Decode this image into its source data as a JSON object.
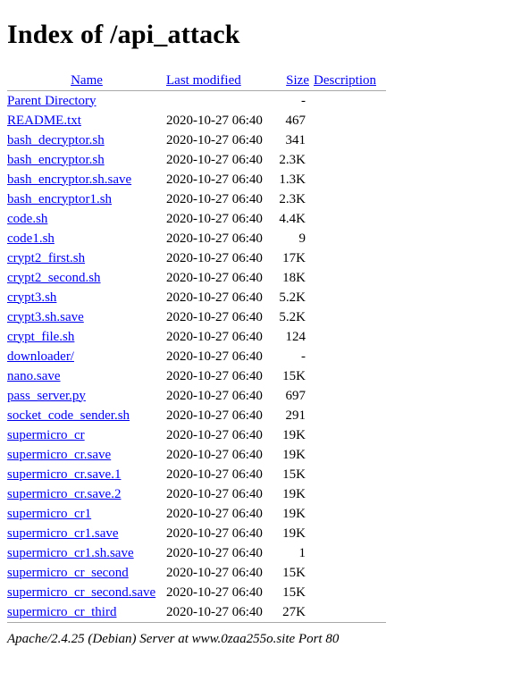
{
  "page": {
    "title": "Index of /api_attack"
  },
  "table": {
    "headers": {
      "name": "Name",
      "last_modified": "Last modified",
      "size": "Size",
      "description": "Description"
    },
    "parent": {
      "name": "Parent Directory",
      "last_modified": "",
      "size": "-",
      "description": ""
    },
    "rows": [
      {
        "name": "README.txt",
        "last_modified": "2020-10-27 06:40",
        "size": "467",
        "description": ""
      },
      {
        "name": "bash_decryptor.sh",
        "last_modified": "2020-10-27 06:40",
        "size": "341",
        "description": ""
      },
      {
        "name": "bash_encryptor.sh",
        "last_modified": "2020-10-27 06:40",
        "size": "2.3K",
        "description": ""
      },
      {
        "name": "bash_encryptor.sh.save",
        "last_modified": "2020-10-27 06:40",
        "size": "1.3K",
        "description": ""
      },
      {
        "name": "bash_encryptor1.sh",
        "last_modified": "2020-10-27 06:40",
        "size": "2.3K",
        "description": ""
      },
      {
        "name": "code.sh",
        "last_modified": "2020-10-27 06:40",
        "size": "4.4K",
        "description": ""
      },
      {
        "name": "code1.sh",
        "last_modified": "2020-10-27 06:40",
        "size": "9",
        "description": ""
      },
      {
        "name": "crypt2_first.sh",
        "last_modified": "2020-10-27 06:40",
        "size": "17K",
        "description": ""
      },
      {
        "name": "crypt2_second.sh",
        "last_modified": "2020-10-27 06:40",
        "size": "18K",
        "description": ""
      },
      {
        "name": "crypt3.sh",
        "last_modified": "2020-10-27 06:40",
        "size": "5.2K",
        "description": ""
      },
      {
        "name": "crypt3.sh.save",
        "last_modified": "2020-10-27 06:40",
        "size": "5.2K",
        "description": ""
      },
      {
        "name": "crypt_file.sh",
        "last_modified": "2020-10-27 06:40",
        "size": "124",
        "description": ""
      },
      {
        "name": "downloader/",
        "last_modified": "2020-10-27 06:40",
        "size": "-",
        "description": ""
      },
      {
        "name": "nano.save",
        "last_modified": "2020-10-27 06:40",
        "size": "15K",
        "description": ""
      },
      {
        "name": "pass_server.py",
        "last_modified": "2020-10-27 06:40",
        "size": "697",
        "description": ""
      },
      {
        "name": "socket_code_sender.sh",
        "last_modified": "2020-10-27 06:40",
        "size": "291",
        "description": ""
      },
      {
        "name": "supermicro_cr",
        "last_modified": "2020-10-27 06:40",
        "size": "19K",
        "description": ""
      },
      {
        "name": "supermicro_cr.save",
        "last_modified": "2020-10-27 06:40",
        "size": "19K",
        "description": ""
      },
      {
        "name": "supermicro_cr.save.1",
        "last_modified": "2020-10-27 06:40",
        "size": "15K",
        "description": ""
      },
      {
        "name": "supermicro_cr.save.2",
        "last_modified": "2020-10-27 06:40",
        "size": "19K",
        "description": ""
      },
      {
        "name": "supermicro_cr1",
        "last_modified": "2020-10-27 06:40",
        "size": "19K",
        "description": ""
      },
      {
        "name": "supermicro_cr1.save",
        "last_modified": "2020-10-27 06:40",
        "size": "19K",
        "description": ""
      },
      {
        "name": "supermicro_cr1.sh.save",
        "last_modified": "2020-10-27 06:40",
        "size": "1",
        "description": ""
      },
      {
        "name": "supermicro_cr_second",
        "last_modified": "2020-10-27 06:40",
        "size": "15K",
        "description": ""
      },
      {
        "name": "supermicro_cr_second.save",
        "last_modified": "2020-10-27 06:40",
        "size": "15K",
        "description": ""
      },
      {
        "name": "supermicro_cr_third",
        "last_modified": "2020-10-27 06:40",
        "size": "27K",
        "description": ""
      }
    ]
  },
  "footer": {
    "server_signature": "Apache/2.4.25 (Debian) Server at www.0zaa255o.site Port 80"
  },
  "colors": {
    "link": "#0000EE",
    "text": "#000000",
    "rule": "#A8A8A8",
    "background": "#FFFFFF"
  }
}
